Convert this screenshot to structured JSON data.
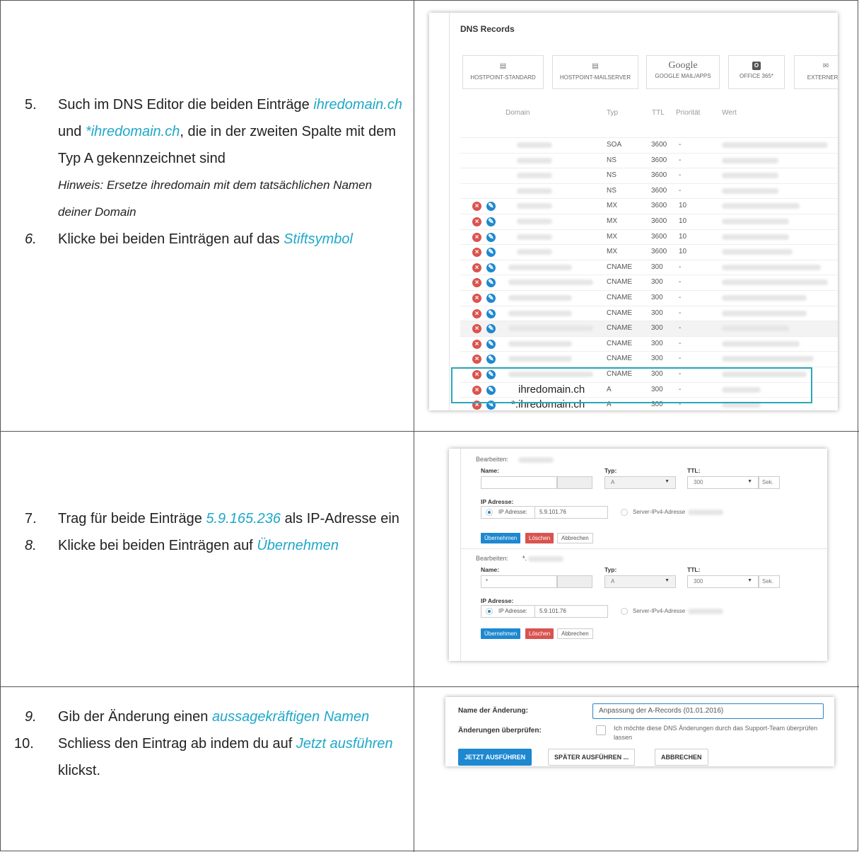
{
  "section1": {
    "steps": [
      {
        "num": "5.",
        "parts": [
          {
            "t": "Such im DNS Editor die beiden Einträge ",
            "acc": false
          },
          {
            "t": "ihredomain.ch",
            "acc": true
          },
          {
            "t": " und ",
            "acc": false
          },
          {
            "t": "*ihredomain.ch",
            "acc": true
          },
          {
            "t": ", die in der zweiten Spalte mit dem Typ A gekennzeichnet sind",
            "acc": false
          }
        ],
        "hint": "Hinweis: Ersetze ihredomain mit dem tatsächlichen Namen deiner Domain"
      },
      {
        "num": "6.",
        "parts": [
          {
            "t": "Klicke bei beiden Einträgen auf das ",
            "acc": false
          },
          {
            "t": "Stiftsymbol",
            "acc": true
          }
        ]
      }
    ],
    "panel": {
      "title": "DNS Records",
      "presets": [
        "HOSTPOINT-STANDARD",
        "HOSTPOINT-MAILSERVER",
        "GOOGLE MAIL/APPS",
        "OFFICE 365*",
        "EXTERNER M"
      ],
      "google_logo": "Google",
      "columns": {
        "domain": "Domain",
        "type": "Typ",
        "ttl": "TTL",
        "priority": "Priorität",
        "value": "Wert"
      },
      "rows": [
        {
          "type": "SOA",
          "ttl": "3600",
          "prio": "-",
          "actions": false
        },
        {
          "type": "NS",
          "ttl": "3600",
          "prio": "-",
          "actions": false
        },
        {
          "type": "NS",
          "ttl": "3600",
          "prio": "-",
          "actions": false
        },
        {
          "type": "NS",
          "ttl": "3600",
          "prio": "-",
          "actions": false
        },
        {
          "type": "MX",
          "ttl": "3600",
          "prio": "10",
          "actions": true
        },
        {
          "type": "MX",
          "ttl": "3600",
          "prio": "10",
          "actions": true
        },
        {
          "type": "MX",
          "ttl": "3600",
          "prio": "10",
          "actions": true
        },
        {
          "type": "MX",
          "ttl": "3600",
          "prio": "10",
          "actions": true
        },
        {
          "type": "CNAME",
          "ttl": "300",
          "prio": "-",
          "actions": true
        },
        {
          "type": "CNAME",
          "ttl": "300",
          "prio": "-",
          "actions": true
        },
        {
          "type": "CNAME",
          "ttl": "300",
          "prio": "-",
          "actions": true
        },
        {
          "type": "CNAME",
          "ttl": "300",
          "prio": "-",
          "actions": true
        },
        {
          "type": "CNAME",
          "ttl": "300",
          "prio": "-",
          "actions": true
        },
        {
          "type": "CNAME",
          "ttl": "300",
          "prio": "-",
          "actions": true
        },
        {
          "type": "CNAME",
          "ttl": "300",
          "prio": "-",
          "actions": true
        },
        {
          "type": "CNAME",
          "ttl": "300",
          "prio": "-",
          "actions": true
        },
        {
          "type": "A",
          "ttl": "300",
          "prio": "-",
          "actions": true,
          "domain": "ihredomain.ch"
        },
        {
          "type": "A",
          "ttl": "300",
          "prio": "-",
          "actions": true,
          "domain": "*.ihredomain.ch"
        }
      ]
    }
  },
  "section2": {
    "steps": [
      {
        "num": "7.",
        "parts": [
          {
            "t": "Trag für beide Einträge ",
            "acc": false
          },
          {
            "t": "5.9.165.236",
            "acc": true
          },
          {
            "t": " als IP-Adresse ein",
            "acc": false
          }
        ]
      },
      {
        "num": "8.",
        "parts": [
          {
            "t": "Klicke bei beiden Einträgen auf ",
            "acc": false
          },
          {
            "t": "Übernehmen",
            "acc": true
          }
        ]
      }
    ],
    "panel": {
      "edit_label": "Bearbeiten:",
      "forms": [
        {
          "prefix": "",
          "name_value": ""
        },
        {
          "prefix": "*.",
          "name_value": "*"
        }
      ],
      "name_label": "Name:",
      "type_label": "Typ:",
      "type_value": "A",
      "ttl_label": "TTL:",
      "ttl_value": "300",
      "ttl_unit": "Sek.",
      "ip_label": "IP Adresse:",
      "ip_radio_label": "IP Adresse:",
      "ip_value": "5.9.101.76",
      "server_radio_label": "Server-IPv4-Adresse",
      "btn_apply": "Übernehmen",
      "btn_delete": "Löschen",
      "btn_cancel": "Abbrechen"
    }
  },
  "section3": {
    "steps": [
      {
        "num": "9.",
        "parts": [
          {
            "t": "Gib der Änderung einen ",
            "acc": false
          },
          {
            "t": "aussagekräftigen Namen",
            "acc": true
          }
        ]
      },
      {
        "num": "10.",
        "parts": [
          {
            "t": "Schliess den Eintrag ab indem du auf ",
            "acc": false
          },
          {
            "t": "Jetzt ausführen",
            "acc": true
          },
          {
            "t": " klickst.",
            "acc": false
          }
        ]
      }
    ],
    "panel": {
      "name_label": "Name der Änderung:",
      "name_value": "Anpassung der A-Records (01.01.2016)",
      "review_label": "Änderungen überprüfen:",
      "review_text": "Ich möchte diese DNS Änderungen durch das Support-Team überprüfen lassen",
      "btn_now": "JETZT AUSFÜHREN",
      "btn_later": "SPÄTER AUSFÜHREN ...",
      "btn_cancel": "ABBRECHEN"
    }
  }
}
